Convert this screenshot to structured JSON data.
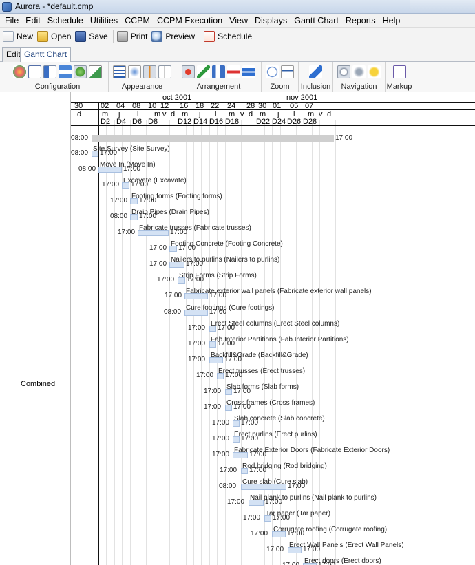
{
  "window": {
    "title": "Aurora - *default.cmp"
  },
  "menu": [
    "File",
    "Edit",
    "Schedule",
    "Utilities",
    "CCPM",
    "CCPM Execution",
    "View",
    "Displays",
    "Gantt Chart",
    "Reports",
    "Help"
  ],
  "toolbar": {
    "new": "New",
    "open": "Open",
    "save": "Save",
    "print": "Print",
    "preview": "Preview",
    "schedule": "Schedule"
  },
  "tabs": [
    "Edit",
    "Gantt Chart"
  ],
  "ribbon": {
    "configuration": "Configuration",
    "appearance": "Appearance",
    "arrangement": "Arrangement",
    "zoom": "Zoom",
    "inclusion": "Inclusion",
    "navigation": "Navigation",
    "markup": "Markup"
  },
  "gantt": {
    "row_label": "Combined",
    "months": [
      "oct 2001",
      "nov 2001"
    ],
    "day_numbers": [
      "30",
      "02",
      "04",
      "08",
      "10",
      "12",
      "16",
      "18",
      "22",
      "24",
      "28",
      "30",
      "01",
      "05",
      "07"
    ],
    "weekdays": [
      "d",
      "m",
      "j",
      "l",
      "m",
      "v",
      "d",
      "m",
      "j",
      "l",
      "m",
      "v",
      "d",
      "m",
      "j",
      "l",
      "m",
      "v",
      "d"
    ],
    "day_codes": [
      "D2",
      "D4",
      "D6",
      "D8",
      "D12",
      "D14",
      "D16",
      "D18",
      "D22",
      "D24",
      "D26",
      "D28"
    ],
    "summary": {
      "start": "08:00",
      "end": "17:00"
    },
    "tasks": [
      {
        "name": "Site Survey (Site Survey)",
        "start": "08:00",
        "end": "17:00"
      },
      {
        "name": "Move In (Move In)",
        "start": "08:00",
        "end": "17:00"
      },
      {
        "name": "Excavate (Excavate)",
        "start": "17:00",
        "end": "17:00"
      },
      {
        "name": "Footing forms (Footing forms)",
        "start": "17:00",
        "end": "17:00"
      },
      {
        "name": "Drain Pipes (Drain Pipes)",
        "start": "08:00",
        "end": "17:00"
      },
      {
        "name": "Fabricate trusses (Fabricate trusses)",
        "start": "17:00",
        "end": "17:00"
      },
      {
        "name": "Footing Concrete (Footing Concrete)",
        "start": "17:00",
        "end": "17:00"
      },
      {
        "name": "Nailers to purlins (Nailers to purlins)",
        "start": "17:00",
        "end": "17:00"
      },
      {
        "name": "Strip Forms (Strip Forms)",
        "start": "17:00",
        "end": "17:00"
      },
      {
        "name": "Fabricate exterior wall panels (Fabricate exterior wall panels)",
        "start": "17:00",
        "end": "17:00"
      },
      {
        "name": "Cure footings (Cure footings)",
        "start": "08:00",
        "end": "17:00"
      },
      {
        "name": "Erect Steel columns (Erect Steel columns)",
        "start": "17:00",
        "end": "17:00"
      },
      {
        "name": "Fab.Interior Partitions (Fab.Interior Partitions)",
        "start": "17:00",
        "end": "17:00"
      },
      {
        "name": "Backfill&Grade (Backfill&Grade)",
        "start": "17:00",
        "end": "17:00"
      },
      {
        "name": "Erect trusses (Erect trusses)",
        "start": "17:00",
        "end": "17:00"
      },
      {
        "name": "Slab forms (Slab forms)",
        "start": "17:00",
        "end": "17:00"
      },
      {
        "name": "Cross frames (Cross frames)",
        "start": "17:00",
        "end": "17:00"
      },
      {
        "name": "Slab concrete (Slab concrete)",
        "start": "17:00",
        "end": "17:00"
      },
      {
        "name": "Erect purlins (Erect purlins)",
        "start": "17:00",
        "end": "17:00"
      },
      {
        "name": "Fabricate Exterior Doors (Fabricate Exterior Doors)",
        "start": "17:00",
        "end": "17:00"
      },
      {
        "name": "Rod bridging (Rod bridging)",
        "start": "17:00",
        "end": "17:00"
      },
      {
        "name": "Cure slab (Cure slab)",
        "start": "08:00",
        "end": "17:00"
      },
      {
        "name": "Nail plank to purlins (Nail plank to purlins)",
        "start": "17:00",
        "end": "17:00"
      },
      {
        "name": "Tar paper (Tar paper)",
        "start": "17:00",
        "end": "17:00"
      },
      {
        "name": "Corrugate roofing (Corrugate roofing)",
        "start": "17:00",
        "end": "17:00"
      },
      {
        "name": "Erect Wall Panels (Erect Wall Panels)",
        "start": "17:00",
        "end": "17:00"
      },
      {
        "name": "Erect doors (Erect doors)",
        "start": "17:00",
        "end": "17:00"
      }
    ]
  }
}
